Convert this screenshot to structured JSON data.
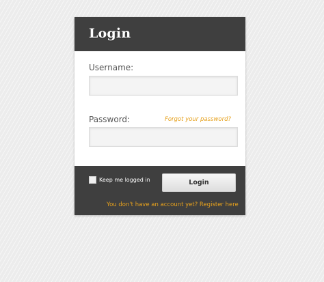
{
  "header": {
    "title": "Login"
  },
  "form": {
    "username_label": "Username:",
    "username_value": "",
    "username_placeholder": "",
    "password_label": "Password:",
    "password_value": "",
    "password_placeholder": "",
    "forgot_link": "Forgot your password?"
  },
  "footer": {
    "remember_label": "Keep me logged in",
    "remember_checked": false,
    "login_button": "Login",
    "register_link": "You don't have an account yet? Register here"
  },
  "colors": {
    "panel_dark": "#3f3f3f",
    "accent_link": "#e6a11d",
    "page_background": "#ececec"
  }
}
